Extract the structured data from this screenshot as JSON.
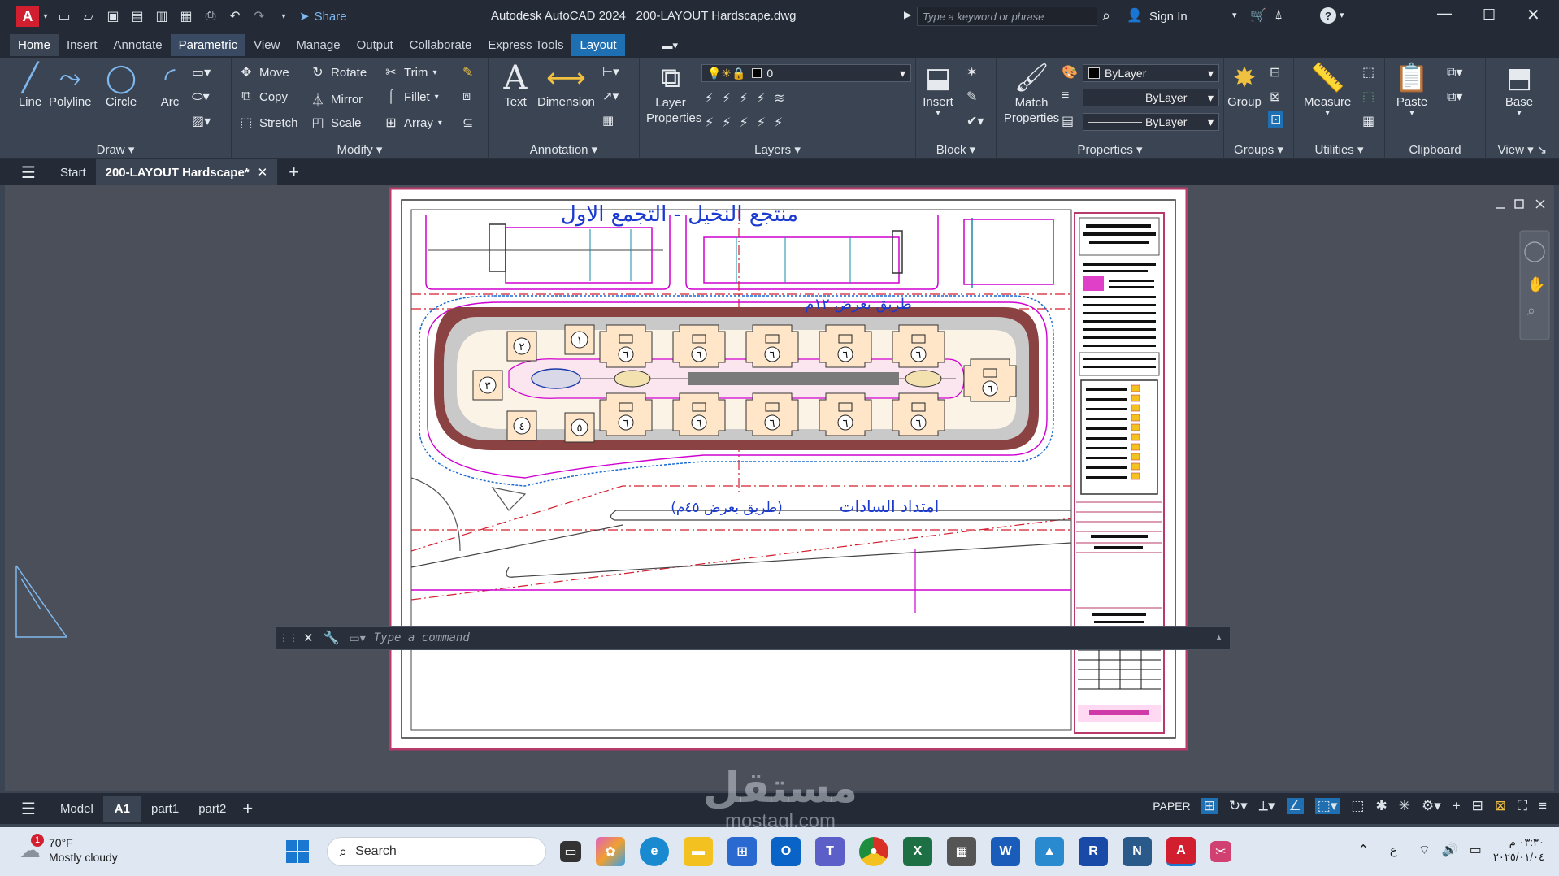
{
  "app": {
    "title": "Autodesk AutoCAD 2024",
    "document": "200-LAYOUT Hardscape.dwg",
    "share": "Share",
    "search_placeholder": "Type a keyword or phrase",
    "sign_in": "Sign In"
  },
  "ribbon_tabs": [
    "Home",
    "Insert",
    "Annotate",
    "Parametric",
    "View",
    "Manage",
    "Output",
    "Collaborate",
    "Express Tools",
    "Layout"
  ],
  "draw": {
    "panel": "Draw",
    "line": "Line",
    "polyline": "Polyline",
    "circle": "Circle",
    "arc": "Arc"
  },
  "modify": {
    "panel": "Modify",
    "move": "Move",
    "rotate": "Rotate",
    "trim": "Trim",
    "copy": "Copy",
    "mirror": "Mirror",
    "fillet": "Fillet",
    "stretch": "Stretch",
    "scale": "Scale",
    "array": "Array"
  },
  "annotation": {
    "panel": "Annotation",
    "text": "Text",
    "dimension": "Dimension"
  },
  "layers": {
    "panel": "Layers",
    "layer_properties": "Layer Properties",
    "current_layer": "0"
  },
  "block": {
    "panel": "Block",
    "insert": "Insert"
  },
  "properties": {
    "panel": "Properties",
    "match": "Match Properties",
    "color": "ByLayer",
    "linetype": "ByLayer",
    "lineweight": "ByLayer"
  },
  "groups": {
    "panel": "Groups",
    "group": "Group"
  },
  "utilities": {
    "panel": "Utilities",
    "measure": "Measure"
  },
  "clipboard": {
    "panel": "Clipboard",
    "paste": "Paste"
  },
  "view": {
    "panel": "View",
    "base": "Base"
  },
  "doc_tabs": {
    "start": "Start",
    "current": "200-LAYOUT Hardscape*"
  },
  "drawing": {
    "title_top": "منتجع النخيل - التجمع الاول",
    "road_12": "طريق بعرض ١٢م",
    "road_45_name": "امتداد السادات",
    "road_45_width": "(طريق بعرض ٤٥م)",
    "building_top": [
      "٦",
      "٦",
      "٦",
      "٦",
      "٦"
    ],
    "building_bottom": [
      "٦",
      "٦",
      "٦",
      "٦",
      "٦"
    ],
    "villas": [
      "١",
      "٢",
      "٣",
      "٤",
      "٥"
    ],
    "east_building": "٦"
  },
  "command": {
    "placeholder": "Type a command"
  },
  "layout_tabs": {
    "model": "Model",
    "a1": "A1",
    "part1": "part1",
    "part2": "part2",
    "paper": "PAPER"
  },
  "watermark": {
    "arabic": "مستقل",
    "latin": "mostaql.com"
  },
  "taskbar": {
    "temp": "70°F",
    "weather": "Mostly cloudy",
    "badge": "1",
    "search": "Search",
    "time": "٠٣:٣٠ م",
    "date": "٢٠٢٥/٠١/٠٤",
    "lang": "ع"
  }
}
